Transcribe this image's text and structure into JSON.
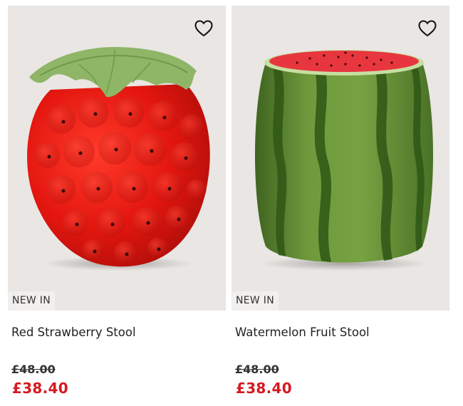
{
  "products": [
    {
      "title": "Red Strawberry Stool",
      "badge": "NEW IN",
      "was_price": "£48.00",
      "price": "£38.40",
      "image_icon": "strawberry-stool-image",
      "wishlist_icon": "heart-outline-icon"
    },
    {
      "title": "Watermelon Fruit Stool",
      "badge": "NEW IN",
      "was_price": "£48.00",
      "price": "£38.40",
      "image_icon": "watermelon-stool-image",
      "wishlist_icon": "heart-outline-icon"
    }
  ],
  "colors": {
    "image_background": "#e9e6e3",
    "sale_price": "#d7181f",
    "strawberry_red": "#e01a14",
    "leaf_green": "#8fb567",
    "watermelon_green": "#5f8a32"
  }
}
